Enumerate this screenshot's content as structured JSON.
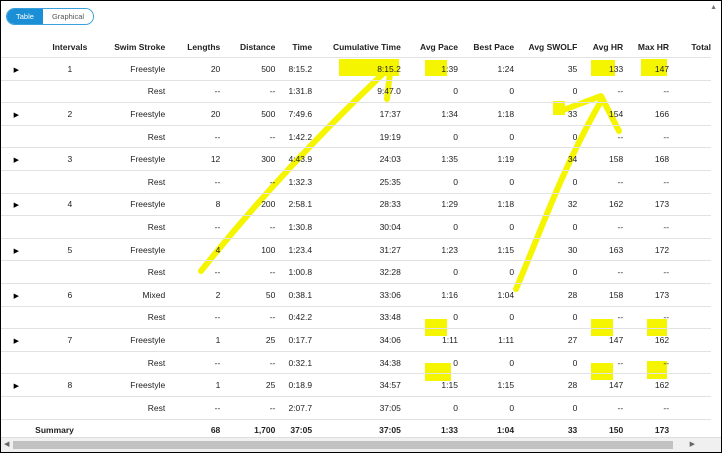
{
  "toggle": {
    "table_label": "Table",
    "graphical_label": "Graphical"
  },
  "columns": [
    "",
    "Intervals",
    "Swim Stroke",
    "Lengths",
    "Distance",
    "Time",
    "Cumulative Time",
    "Avg Pace",
    "Best Pace",
    "Avg SWOLF",
    "Avg HR",
    "Max HR",
    "Total"
  ],
  "rows": [
    {
      "exp": "▶",
      "cells": [
        "1",
        "Freestyle",
        "20",
        "500",
        "8:15.2",
        "8:15.2",
        "1:39",
        "1:24",
        "35",
        "133",
        "147",
        ""
      ]
    },
    {
      "exp": "",
      "cells": [
        "",
        "Rest",
        "--",
        "--",
        "1:31.8",
        "9:47.0",
        "0",
        "0",
        "0",
        "--",
        "--",
        ""
      ]
    },
    {
      "exp": "▶",
      "cells": [
        "2",
        "Freestyle",
        "20",
        "500",
        "7:49.6",
        "17:37",
        "1:34",
        "1:18",
        "33",
        "154",
        "166",
        ""
      ]
    },
    {
      "exp": "",
      "cells": [
        "",
        "Rest",
        "--",
        "--",
        "1:42.2",
        "19:19",
        "0",
        "0",
        "0",
        "--",
        "--",
        ""
      ]
    },
    {
      "exp": "▶",
      "cells": [
        "3",
        "Freestyle",
        "12",
        "300",
        "4:43.9",
        "24:03",
        "1:35",
        "1:19",
        "34",
        "158",
        "168",
        ""
      ]
    },
    {
      "exp": "",
      "cells": [
        "",
        "Rest",
        "--",
        "--",
        "1:32.3",
        "25:35",
        "0",
        "0",
        "0",
        "--",
        "--",
        ""
      ]
    },
    {
      "exp": "▶",
      "cells": [
        "4",
        "Freestyle",
        "8",
        "200",
        "2:58.1",
        "28:33",
        "1:29",
        "1:18",
        "32",
        "162",
        "173",
        ""
      ]
    },
    {
      "exp": "",
      "cells": [
        "",
        "Rest",
        "--",
        "--",
        "1:30.8",
        "30:04",
        "0",
        "0",
        "0",
        "--",
        "--",
        ""
      ]
    },
    {
      "exp": "▶",
      "cells": [
        "5",
        "Freestyle",
        "4",
        "100",
        "1:23.4",
        "31:27",
        "1:23",
        "1:15",
        "30",
        "163",
        "172",
        ""
      ]
    },
    {
      "exp": "",
      "cells": [
        "",
        "Rest",
        "--",
        "--",
        "1:00.8",
        "32:28",
        "0",
        "0",
        "0",
        "--",
        "--",
        ""
      ]
    },
    {
      "exp": "▶",
      "cells": [
        "6",
        "Mixed",
        "2",
        "50",
        "0:38.1",
        "33:06",
        "1:16",
        "1:04",
        "28",
        "158",
        "173",
        ""
      ]
    },
    {
      "exp": "",
      "cells": [
        "",
        "Rest",
        "--",
        "--",
        "0:42.2",
        "33:48",
        "0",
        "0",
        "0",
        "--",
        "--",
        ""
      ]
    },
    {
      "exp": "▶",
      "cells": [
        "7",
        "Freestyle",
        "1",
        "25",
        "0:17.7",
        "34:06",
        "1:11",
        "1:11",
        "27",
        "147",
        "162",
        ""
      ]
    },
    {
      "exp": "",
      "cells": [
        "",
        "Rest",
        "--",
        "--",
        "0:32.1",
        "34:38",
        "0",
        "0",
        "0",
        "--",
        "--",
        ""
      ]
    },
    {
      "exp": "▶",
      "cells": [
        "8",
        "Freestyle",
        "1",
        "25",
        "0:18.9",
        "34:57",
        "1:15",
        "1:15",
        "28",
        "147",
        "162",
        ""
      ]
    },
    {
      "exp": "",
      "cells": [
        "",
        "Rest",
        "--",
        "--",
        "2:07.7",
        "37:05",
        "0",
        "0",
        "0",
        "--",
        "--",
        ""
      ]
    }
  ],
  "summary": {
    "label": "Summary",
    "cells": [
      "",
      "68",
      "1,700",
      "37:05",
      "37:05",
      "1:33",
      "1:04",
      "33",
      "150",
      "173",
      ""
    ]
  },
  "highlight_color": "#f5f500"
}
